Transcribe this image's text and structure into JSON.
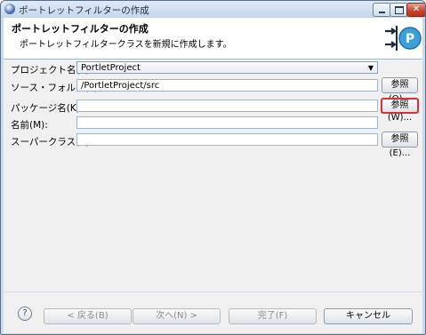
{
  "window": {
    "title": "ポートレットフィルターの作成",
    "close_glyph": "✕"
  },
  "header": {
    "title": "ポートレットフィルターの作成",
    "description": "ポートレットフィルタークラスを新規に作成します。"
  },
  "form": {
    "project_label": "プロジェクト名(P):",
    "project_value": "PortletProject",
    "source_folder_label": "ソース・フォルダ(F):",
    "source_folder_value": "/PortletProject/src",
    "source_browse_label": "参照(O)...",
    "package_label": "パッケージ名(K):",
    "package_value": "",
    "package_browse_label": "参照(W)...",
    "name_label": "名前(M):",
    "name_value": "",
    "superclass_label": "スーパークラス(S):",
    "superclass_value": "",
    "superclass_browse_label": "参照(E)..."
  },
  "footer": {
    "help_glyph": "?",
    "back_label": "< 戻る(B)",
    "next_label": "次へ(N) >",
    "finish_label": "完了(F)",
    "cancel_label": "キャンセル"
  },
  "colors": {
    "highlight": "#d93035",
    "window_frame": "#c8dcf0"
  }
}
